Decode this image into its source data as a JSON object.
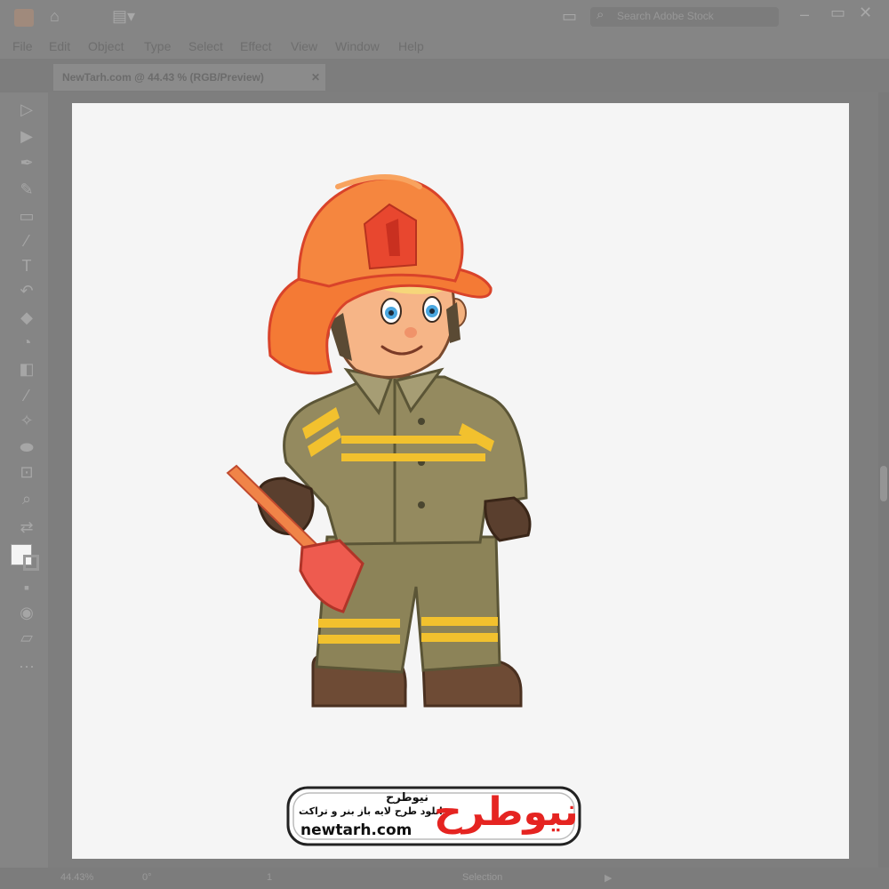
{
  "menu": {
    "items": [
      "File",
      "Edit",
      "Object",
      "Type",
      "Select",
      "Effect",
      "View",
      "Window",
      "Help"
    ]
  },
  "search": {
    "placeholder": "Search Adobe Stock"
  },
  "document_tab": {
    "label": "NewTarh.com @ 44.43 % (RGB/Preview)"
  },
  "status": {
    "zoom": "44.43%",
    "rotation": "0°",
    "artboard": "1",
    "tool": "Selection"
  },
  "logo": {
    "brand_fa": "نیوطرح",
    "tagline_fa": "دانلود طرح لایه باز بنر و تراکت",
    "url": "newtarh.com",
    "mark_fa": "نیوطرح"
  },
  "colors": {
    "app_bg": "#858585",
    "artboard": "#f5f5f5",
    "helmet": "#f47a35",
    "uniform": "#8c8358",
    "stripe": "#f2c12e",
    "axe": "#ee5b4f",
    "logo_red": "#e52421"
  }
}
